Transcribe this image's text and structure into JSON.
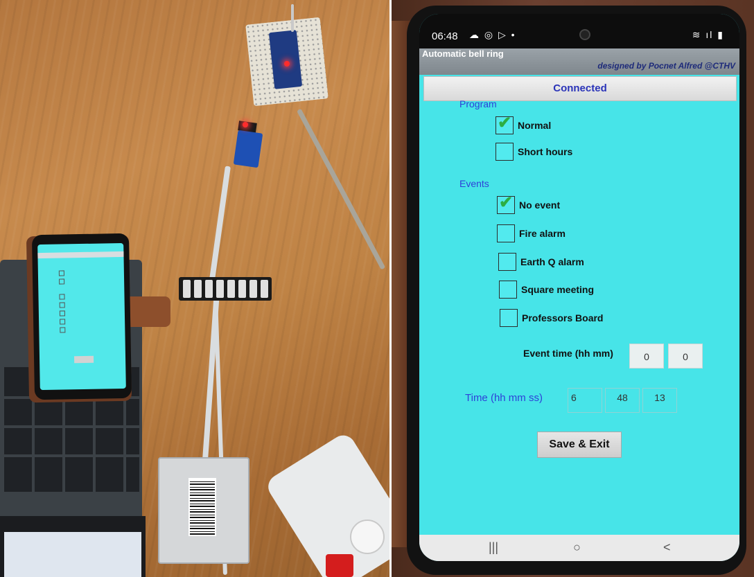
{
  "status_bar": {
    "time": "06:48",
    "notification_icons": "☁ ◎ ▷ •",
    "signal_icons": "≋ ıl ▮"
  },
  "app": {
    "title": "Automatic bell ring",
    "credit": "designed by Pocnet Alfred @CTHV"
  },
  "connection": {
    "status": "Connected"
  },
  "program": {
    "label": "Program",
    "options": [
      {
        "label": "Normal",
        "checked": true
      },
      {
        "label": "Short hours",
        "checked": false
      }
    ]
  },
  "events": {
    "label": "Events",
    "options": [
      {
        "label": "No event",
        "checked": true
      },
      {
        "label": "Fire alarm",
        "checked": false
      },
      {
        "label": "Earth Q alarm",
        "checked": false
      },
      {
        "label": "Square meeting",
        "checked": false
      },
      {
        "label": "Professors Board",
        "checked": false
      }
    ],
    "event_time": {
      "label": "Event time (hh mm)",
      "hh": "0",
      "mm": "0"
    }
  },
  "clock": {
    "label": "Time (hh mm ss)",
    "hh": "6",
    "mm": "48",
    "ss": "13"
  },
  "actions": {
    "save_exit": "Save & Exit"
  },
  "nav": {
    "recents": "|||",
    "home": "○",
    "back": "<"
  },
  "colors": {
    "screen_bg": "#47e4e8",
    "accent_blue": "#2e41d8",
    "check_green": "#2cae43",
    "wood": "#c78a4d"
  }
}
